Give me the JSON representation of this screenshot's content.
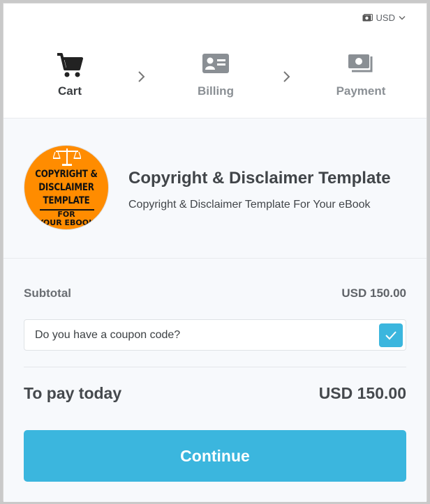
{
  "currency": {
    "code": "USD",
    "icon": "cash-icon",
    "chevron": "chevron-down-icon"
  },
  "steps": [
    {
      "label": "Cart",
      "icon": "cart-icon",
      "active": true
    },
    {
      "label": "Billing",
      "icon": "id-card-icon",
      "active": false
    },
    {
      "label": "Payment",
      "icon": "money-icon",
      "active": false
    }
  ],
  "product": {
    "title": "Copyright & Disclaimer Template",
    "subtitle": "Copyright & Disclaimer Template For Your eBook",
    "thumb": {
      "line1": "COPYRIGHT &",
      "line2": "DISCLAIMER",
      "line3": "TEMPLATE",
      "line4": "FOR",
      "line5": "YOUR EBOOK",
      "bg_color": "#ff8c00"
    }
  },
  "summary": {
    "subtotal_label": "Subtotal",
    "subtotal_value": "USD 150.00",
    "coupon_question": "Do you have a coupon code?",
    "coupon_checked": true,
    "pay_label": "To pay today",
    "pay_value": "USD 150.00"
  },
  "continue_label": "Continue",
  "colors": {
    "accent": "#3bb6de",
    "text_dark": "#3a3d40",
    "text_muted": "#8a8f94",
    "panel_bg": "#f7f9fc"
  }
}
